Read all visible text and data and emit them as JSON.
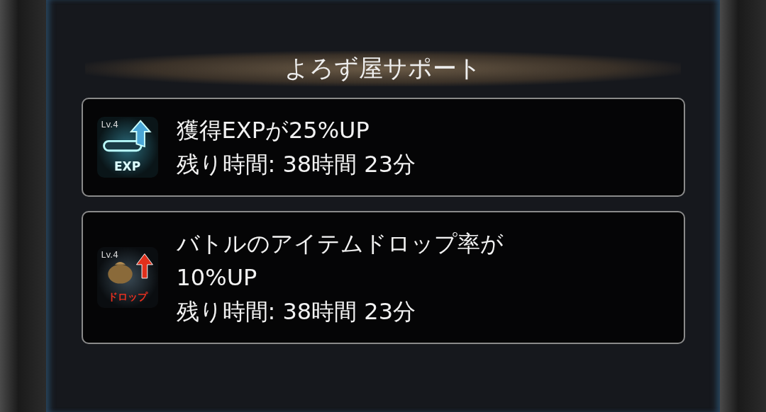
{
  "title": "よろず屋サポート",
  "buffs": [
    {
      "kind": "exp",
      "icon_level": "Lv.4",
      "icon_label": "EXP",
      "lines": [
        "獲得EXPが25%UP"
      ],
      "remaining": "残り時間: 38時間 23分"
    },
    {
      "kind": "drop",
      "icon_level": "Lv.4",
      "icon_label": "ドロップ",
      "lines": [
        "バトルのアイテムドロップ率が",
        "10%UP"
      ],
      "remaining": "残り時間: 38時間 23分"
    }
  ]
}
